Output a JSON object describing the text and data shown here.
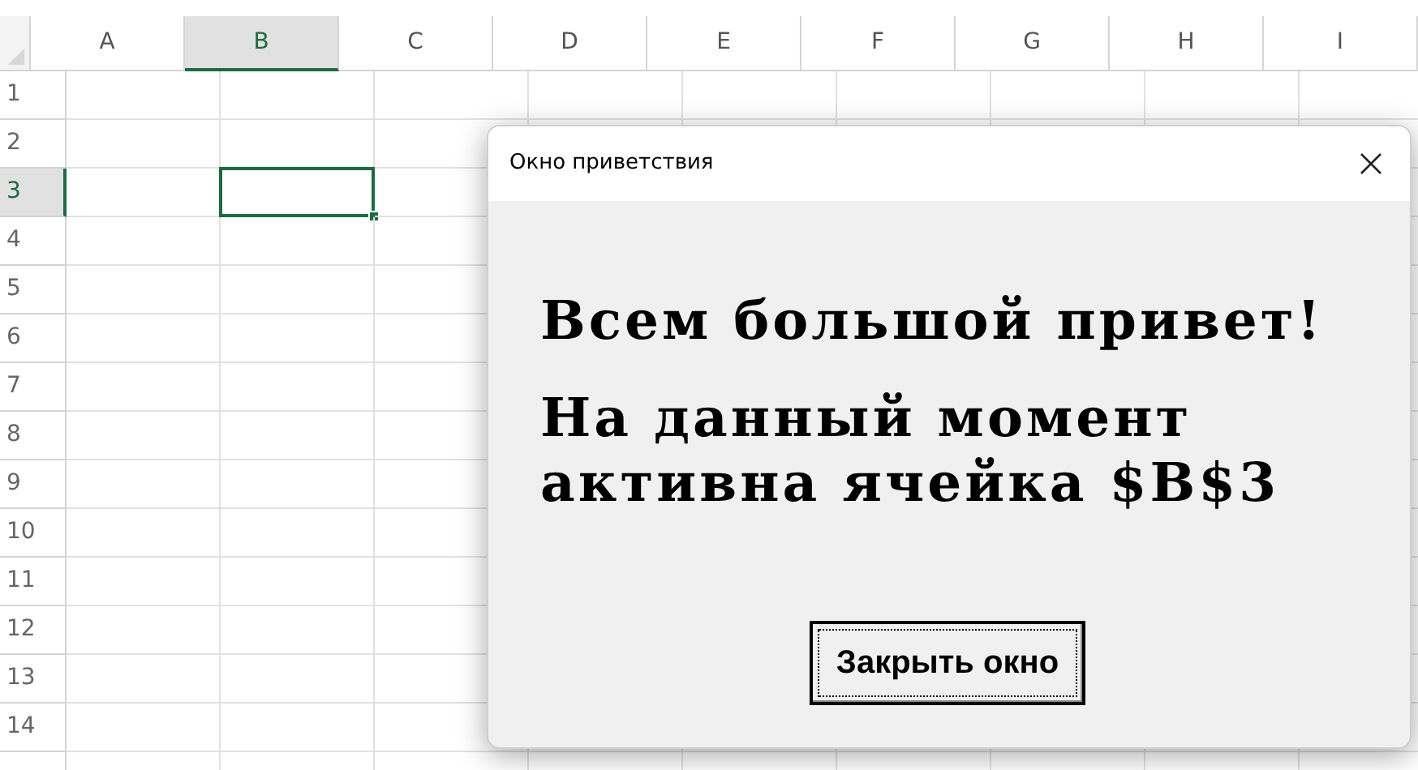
{
  "columns": [
    {
      "label": "A",
      "selected": false
    },
    {
      "label": "B",
      "selected": true
    },
    {
      "label": "C",
      "selected": false
    },
    {
      "label": "D",
      "selected": false
    },
    {
      "label": "E",
      "selected": false
    },
    {
      "label": "F",
      "selected": false
    },
    {
      "label": "G",
      "selected": false
    },
    {
      "label": "H",
      "selected": false
    },
    {
      "label": "I",
      "selected": false
    }
  ],
  "rows": [
    {
      "label": "1",
      "selected": false
    },
    {
      "label": "2",
      "selected": false
    },
    {
      "label": "3",
      "selected": true
    },
    {
      "label": "4",
      "selected": false
    },
    {
      "label": "5",
      "selected": false
    },
    {
      "label": "6",
      "selected": false
    },
    {
      "label": "7",
      "selected": false
    },
    {
      "label": "8",
      "selected": false
    },
    {
      "label": "9",
      "selected": false
    },
    {
      "label": "10",
      "selected": false
    },
    {
      "label": "11",
      "selected": false
    },
    {
      "label": "12",
      "selected": false
    },
    {
      "label": "13",
      "selected": false
    },
    {
      "label": "14",
      "selected": false
    }
  ],
  "dialog": {
    "title": "Окно приветствия",
    "messages": [
      "Всем большой привет!",
      "На данный момент активна ячейка $B$3"
    ],
    "button": "Закрыть окно"
  }
}
